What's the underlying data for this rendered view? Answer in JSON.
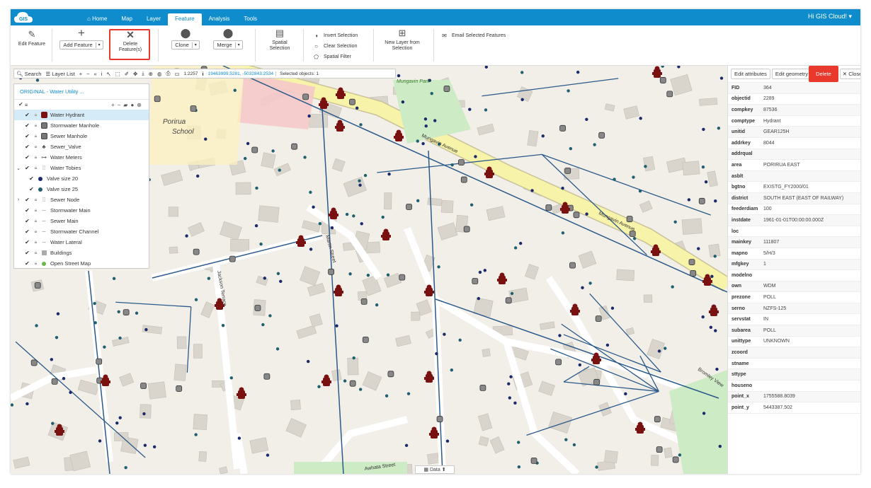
{
  "app": {
    "logo": "GIS",
    "greeting": "Hi GIS Cloud! ▾"
  },
  "nav": {
    "tabs": [
      {
        "label": "Home",
        "icon": "home-icon"
      },
      {
        "label": "Map"
      },
      {
        "label": "Layer"
      },
      {
        "label": "Feature",
        "active": true
      },
      {
        "label": "Analysis"
      },
      {
        "label": "Tools"
      }
    ]
  },
  "ribbon": {
    "edit_feature": "Edit Feature",
    "add_feature": "Add Feature",
    "delete_feature": "Delete Feature(s)",
    "clone": "Clone",
    "merge": "Merge",
    "spatial_selection": "Spatial Selection",
    "invert_selection": "Invert Selection",
    "clear_selection": "Clear Selection",
    "spatial_filter": "Spatial Filter",
    "new_layer_from_selection": "New Layer from Selection",
    "email_selected": "Email Selected Features"
  },
  "map_toolbar": {
    "search": "Search",
    "layer_list": "Layer List",
    "scale": "1:2257",
    "coords": "19463999.5281, -5032843.2534",
    "selected": "Selected objects: 1"
  },
  "layer_panel": {
    "title": "ORIGINAL - Water Utility ...",
    "layers": [
      {
        "label": "Water Hydrant",
        "sym": "hydrant",
        "active": true
      },
      {
        "label": "Stormwater Manhole",
        "sym": "manhole"
      },
      {
        "label": "Sewer Manhole",
        "sym": "manhole"
      },
      {
        "label": "Sewer_Valve",
        "sym": "valve"
      },
      {
        "label": "Water Meters",
        "sym": "meter"
      },
      {
        "label": "Water Tobies",
        "sym": "group",
        "expanded": true
      },
      {
        "label": "Valve size 20",
        "sym": "dot-navy",
        "child": true
      },
      {
        "label": "Valve size 25",
        "sym": "dot-teal",
        "child": true
      },
      {
        "label": "Sewer Node",
        "sym": "group",
        "collapsed": true
      },
      {
        "label": "Stormwater Main",
        "sym": "line"
      },
      {
        "label": "Sewer Main",
        "sym": "line"
      },
      {
        "label": "Stormwater Channel",
        "sym": "line"
      },
      {
        "label": "Water Lateral",
        "sym": "line"
      },
      {
        "label": "Buildings",
        "sym": "square"
      },
      {
        "label": "Open Street Map",
        "sym": "osm"
      }
    ]
  },
  "map_labels": {
    "school": "Porirua",
    "school2": "School",
    "park": "Mungavin Park",
    "mungavin_ave": "Mungavin Avenue",
    "mungavin_ave2": "Mungavin Avenue",
    "martin_st": "Martin Street",
    "jackson_ter": "Jackson Terrace",
    "awhata_st": "Awhata Street",
    "bromley_view": "Bromley View",
    "data_tab": "Data"
  },
  "feature_panel": {
    "edit_attributes": "Edit attributes",
    "edit_geometry": "Edit geometry",
    "delete": "Delete",
    "close": "✕ Close",
    "attributes": [
      {
        "k": "FID",
        "v": "364"
      },
      {
        "k": "objectid",
        "v": "2289"
      },
      {
        "k": "compkey",
        "v": "87536"
      },
      {
        "k": "comptype",
        "v": "Hydrant"
      },
      {
        "k": "unitid",
        "v": "GEAR125H"
      },
      {
        "k": "addrkey",
        "v": "8044"
      },
      {
        "k": "addrqual",
        "v": ""
      },
      {
        "k": "area",
        "v": "PORIRUA EAST"
      },
      {
        "k": "asblt",
        "v": ""
      },
      {
        "k": "bgtno",
        "v": "EXISTG_FY2000/01"
      },
      {
        "k": "district",
        "v": "SOUTH EAST (EAST OF RAILWAY)"
      },
      {
        "k": "feederdiam",
        "v": "100"
      },
      {
        "k": "instdate",
        "v": "1961-01-01T00:00:00.000Z"
      },
      {
        "k": "loc",
        "v": ""
      },
      {
        "k": "mainkey",
        "v": "111807"
      },
      {
        "k": "mapno",
        "v": "5/H/3"
      },
      {
        "k": "mfgkey",
        "v": "1"
      },
      {
        "k": "modelno",
        "v": ""
      },
      {
        "k": "own",
        "v": "WDM"
      },
      {
        "k": "prezone",
        "v": "POLL"
      },
      {
        "k": "serno",
        "v": "NZFS-125"
      },
      {
        "k": "servstat",
        "v": "IN"
      },
      {
        "k": "subarea",
        "v": "POLL"
      },
      {
        "k": "unittype",
        "v": "UNKNOWN"
      },
      {
        "k": "zcoord",
        "v": ""
      },
      {
        "k": "stname",
        "v": ""
      },
      {
        "k": "sttype",
        "v": ""
      },
      {
        "k": "houseno",
        "v": ""
      },
      {
        "k": "point_x",
        "v": "1755588.8039"
      },
      {
        "k": "point_y",
        "v": "5443387.502"
      }
    ]
  },
  "colors": {
    "brand": "#0f8ccc",
    "highlight": "#e8392c",
    "pipe": "#2b5a8a",
    "hydrant": "#7a1111",
    "road_main": "#f7f3a8"
  }
}
